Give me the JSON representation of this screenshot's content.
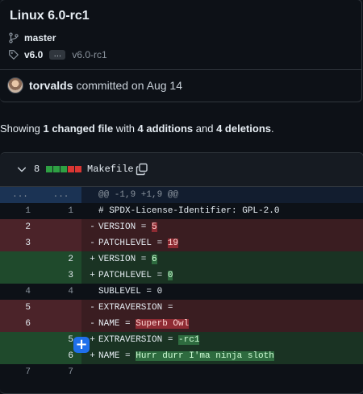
{
  "commit": {
    "title": "Linux 6.0-rc1",
    "branch": "master",
    "tag": "v6.0",
    "tag_ellipsis": "…",
    "tag_range_end": "v6.0-rc1",
    "author": "torvalds",
    "committed_text": "committed on Aug 14"
  },
  "summary": {
    "prefix": "Showing ",
    "changed": "1 changed file",
    "mid1": " with ",
    "additions": "4 additions",
    "mid2": " and ",
    "deletions": "4 deletions",
    "suffix": "."
  },
  "file": {
    "change_count": "8",
    "filename": "Makefile",
    "diffstat": [
      "#2ea043",
      "#2ea043",
      "#2ea043",
      "#da3633",
      "#da3633"
    ],
    "hunk": {
      "old": "...",
      "new": "...",
      "text": "@@ -1,9 +1,9 @@"
    },
    "lines": {
      "l1": {
        "old": "1",
        "new": "1",
        "text": "# SPDX-License-Identifier: GPL-2.0"
      },
      "l2": {
        "old": "2",
        "sign": "-",
        "pre": "VERSION = ",
        "hl": "5"
      },
      "l3": {
        "old": "3",
        "sign": "-",
        "pre": "PATCHLEVEL = ",
        "hl": "19"
      },
      "l4": {
        "new": "2",
        "sign": "+",
        "pre": "VERSION = ",
        "hl": "6"
      },
      "l5": {
        "new": "3",
        "sign": "+",
        "pre": "PATCHLEVEL = ",
        "hl": "0"
      },
      "l6": {
        "old": "4",
        "new": "4",
        "text": "SUBLEVEL = 0"
      },
      "l7": {
        "old": "5",
        "sign": "-",
        "pre": "EXTRAVERSION =",
        "hl": ""
      },
      "l8": {
        "old": "6",
        "sign": "-",
        "pre": "NAME = ",
        "hl": "Superb Owl"
      },
      "l9": {
        "new": "5",
        "sign": "+",
        "pre": "EXTRAVERSION = ",
        "hl": "-rc1"
      },
      "l10": {
        "new": "6",
        "sign": "+",
        "pre": "NAME = ",
        "hl": "Hurr durr I'ma ninja sloth"
      },
      "l11": {
        "old": "7",
        "new": "7",
        "text": ""
      }
    },
    "plus_button": "+"
  }
}
